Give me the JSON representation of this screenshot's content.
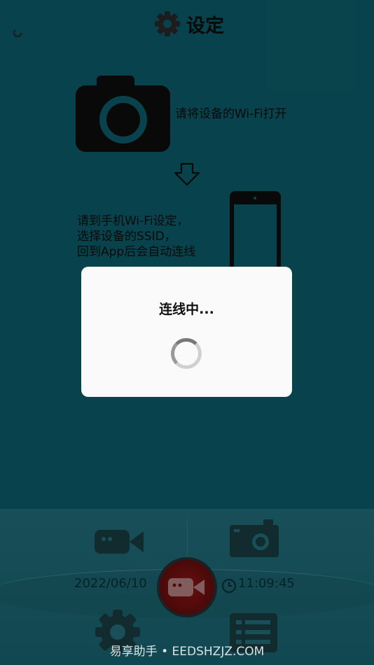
{
  "header": {
    "title": "设定"
  },
  "instructions": {
    "step1": "请将设备的Wi-Fi打开",
    "step2_lines": [
      "请到手机Wi-Fi设定，",
      "选择设备的SSID，",
      "回到App后会自动连线"
    ]
  },
  "bottom_bar": {
    "date": "2022/06/10",
    "time": "11:09:45"
  },
  "dialog": {
    "message": "连线中..."
  },
  "watermark": "易享助手 • EEDSHZJZ.COM",
  "colors": {
    "background": "#0f7383",
    "record": "#b21b1b",
    "dialog": "#fafafa"
  }
}
